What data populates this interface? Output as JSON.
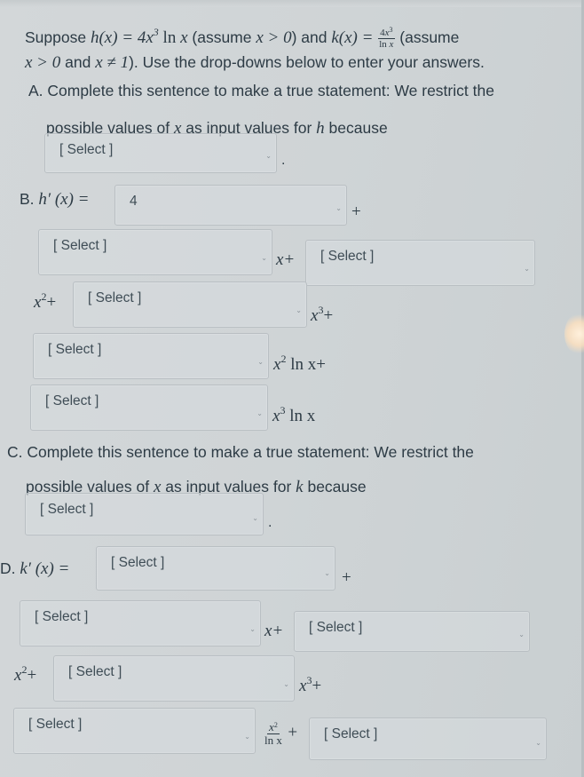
{
  "intro": {
    "part1": "Suppose ",
    "h_def": "h(x) = 4x³ ln x",
    "part2": " (assume ",
    "assume1": "x > 0",
    "part3": ") and ",
    "k_def": "k(x) = ",
    "k_num": "4x³",
    "k_den": "ln x",
    "part4": " (assume",
    "assume2": "x > 0",
    "part5": " and ",
    "assume3": "x ≠ 1",
    "part6": "). Use the drop-downs below to enter your answers."
  },
  "question_a": {
    "label": "A.",
    "line1": "Complete this sentence to make a true statement: We restrict the",
    "line2_pre": "possible values of ",
    "var": "x",
    "line2_mid": " as input values for ",
    "func": "h",
    "line2_post": " because",
    "select_value": "[ Select ]",
    "period": "."
  },
  "question_b": {
    "label": "B.",
    "lhs": "h′ (x) =",
    "select_1_value": "4",
    "plus_1": "+",
    "select_2_value": "[ Select ]",
    "term_x_plus": "x+",
    "select_3_value": "[ Select ]",
    "term_x2_plus": "x",
    "term_x2_sup": "2",
    "term_x2_op": "+",
    "select_4_value": "[ Select ]",
    "term_x3": "x",
    "term_x3_sup": "3",
    "term_x3_op": "+",
    "select_5_value": "[ Select ]",
    "term_x2lnx": "x",
    "term_x2lnx_sup": "2",
    "term_x2lnx_rest": " ln x+",
    "select_6_value": "[ Select ]",
    "term_x3lnx": "x",
    "term_x3lnx_sup": "3",
    "term_x3lnx_rest": " ln x"
  },
  "question_c": {
    "label": "C.",
    "line1": "Complete this sentence to make a true statement: We restrict the",
    "line2_pre": "possible values of ",
    "var": "x",
    "line2_mid": " as input values for ",
    "func": "k",
    "line2_post": " because",
    "select_value": "[ Select ]",
    "period": "."
  },
  "question_d": {
    "label": "D.",
    "lhs": "k′ (x) =",
    "select_1_value": "[ Select ]",
    "plus_1": "+",
    "select_2_value": "[ Select ]",
    "term_x_plus": "x+",
    "select_3_value": "[ Select ]",
    "term_x2_plus": "x",
    "term_x2_sup": "2",
    "term_x2_op": "+",
    "select_4_value": "[ Select ]",
    "term_x3": "x",
    "term_x3_sup": "3",
    "term_x3_op": "+",
    "select_5_value": "[ Select ]",
    "frac_num": "x",
    "frac_num_sup": "2",
    "frac_den": "ln x",
    "frac_op": "+",
    "select_6_value": "[ Select ]"
  }
}
